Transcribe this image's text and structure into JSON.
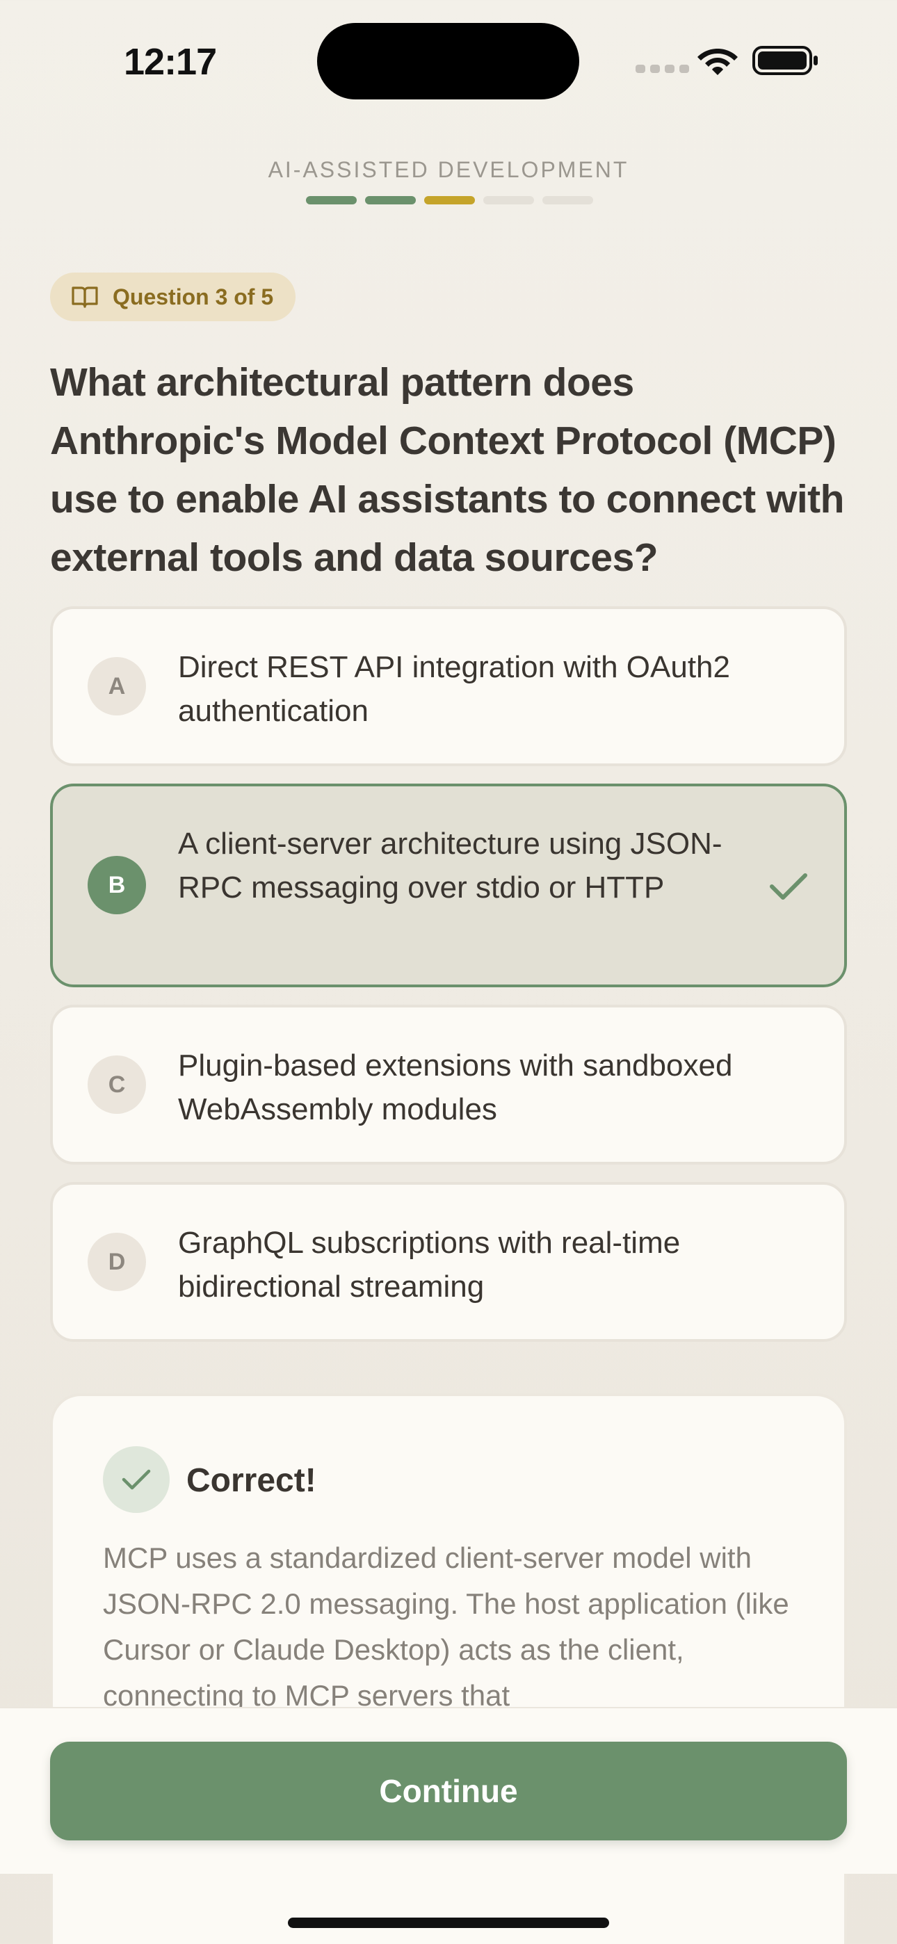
{
  "status_bar": {
    "time": "12:17",
    "icons": [
      "cellular-dots-icon",
      "wifi-icon",
      "battery-icon"
    ]
  },
  "header": {
    "course_title": "AI-ASSISTED DEVELOPMENT",
    "progress": {
      "total": 5,
      "completed": 2,
      "current": 3
    }
  },
  "badge": {
    "icon": "book-open-icon",
    "text": "Question 3 of 5"
  },
  "question": "What architectural pattern does Anthropic's Model Context Protocol (MCP) use to enable AI assistants to connect with external tools and data sources?",
  "options": [
    {
      "letter": "A",
      "text": "Direct REST API integration with OAuth2 authentication",
      "selected": false
    },
    {
      "letter": "B",
      "text": "A client-server architecture using JSON-RPC messaging over stdio or HTTP",
      "selected": true,
      "icon": "checkmark-icon"
    },
    {
      "letter": "C",
      "text": "Plugin-based extensions with sandboxed WebAssembly modules",
      "selected": false
    },
    {
      "letter": "D",
      "text": "GraphQL subscriptions with real-time bidirectional streaming",
      "selected": false
    }
  ],
  "feedback": {
    "icon": "checkmark-icon",
    "title": "Correct!",
    "body": "MCP uses a standardized client-server model with JSON-RPC 2.0 messaging. The host application (like Cursor or Claude Desktop) acts as the client, connecting to MCP servers that"
  },
  "actions": {
    "continue_label": "Continue"
  },
  "colors": {
    "accent_green": "#6b916c",
    "progress_current": "#c5a42a",
    "badge_background": "#ede1c6",
    "badge_text": "#8a6c20",
    "background": "#f3f0e9"
  }
}
